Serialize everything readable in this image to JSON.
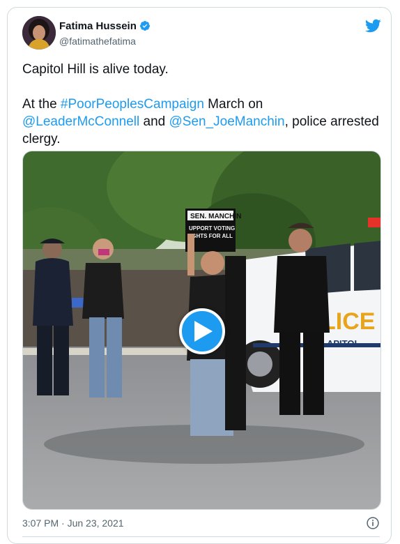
{
  "tweet": {
    "author_name": "Fatima Hussein",
    "author_handle": "@fatimathefatima",
    "paragraph1": "Capitol Hill is alive today.",
    "p2_prefix": "At the ",
    "p2_hashtag": "#PoorPeoplesCampaign",
    "p2_mid1": " March on ",
    "p2_mention1": "@LeaderMcConnell",
    "p2_mid2": " and ",
    "p2_mention2": "@Sen_JoeManchin",
    "p2_suffix": ", police arrested clergy.",
    "timestamp": "3:07 PM · Jun 23, 2021"
  },
  "media": {
    "sign_line1": "SEN. MANCHIN",
    "sign_line2": "UPPORT VOTING",
    "sign_line3": "IGHTS FOR ALL",
    "car_text": "LICE",
    "car_text2": "APITOL"
  },
  "colors": {
    "accent": "#1d9bf0",
    "text": "#0f1419",
    "secondary": "#536471",
    "border": "#cfd9de"
  },
  "icons": [
    "verified-badge-icon",
    "twitter-bird-icon",
    "play-icon",
    "info-icon"
  ]
}
